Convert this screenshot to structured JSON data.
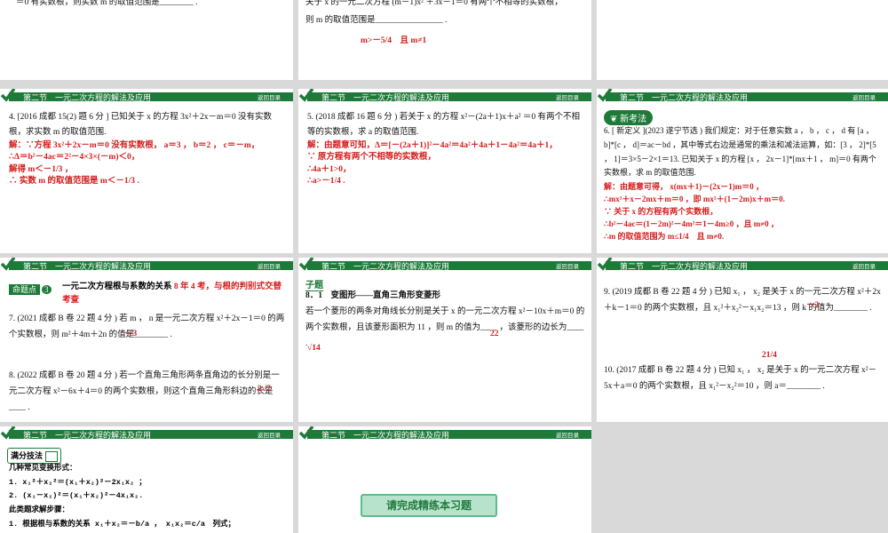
{
  "header_title": "第二节　一元二次方程的解法及应用",
  "back_label": "返回目录",
  "slides": {
    "s1": {
      "line": "＝0 有实数根，则实数 m 的取值范围是________ ."
    },
    "s2": {
      "l1": "关于 x 的一元二次方程 (m－1)x² ＋3x－1＝0 有两个不相等的实数根，",
      "l2": "则 m 的取值范围是________________ .",
      "answer": "m>－5/4　且 m≠1"
    },
    "s4": {
      "q": "4. [2016 成都 15(2) 题 6 分 ] 已知关于 x 的方程 3x²＋2x－m＝0 没有实数根，求实数 m 的取值范围.",
      "sol": [
        "解：∵方程 3x²＋2x－m＝0 没有实数根， a＝3 ， b＝2 ， c＝－m，",
        "∴Δ＝b²－4ac＝2²－4×3×(－m)＜0，",
        "解得 m＜－1/3 ，",
        "∴ 实数 m 的取值范围是 m＜－1/3 ."
      ]
    },
    "s5": {
      "q": "5. (2018 成都 16 题 6 分 ) 若关于 x 的方程 x²－(2a＋1)x＋a² ＝0 有两个不相等的实数根，求 a 的取值范围.",
      "sol": [
        "解：由题意可知，Δ＝[－(2a＋1)]²－4a²＝4a²＋4a＋1－4a²＝4a＋1，",
        "∵ 原方程有两个不相等的实数根，",
        "∴4a＋1>0，",
        "∴a>－1/4 ."
      ]
    },
    "s6": {
      "badge": "新考法",
      "q": "6. [ 新定义 ](2023 遂宁节选 ) 我们规定：对于任意实数 a ， b ， c ， d 有 [a ， b]*[c ， d]＝ac－bd ，其中等式右边是通常的乘法和减法运算，如：[3 ， 2]*[5 ， 1]＝3×5－2×1＝13. 已知关于 x 的方程 [x ， 2x－1]*[mx＋1 ， m]＝0 有两个实数根，求 m 的取值范围.",
      "sol": [
        "解：由题意可得， x(mx＋1)－(2x－1)m＝0 ，",
        "∴mx²＋x－2mx＋m＝0 ，即 mx²＋(1－2m)x＋m＝0.",
        "∵ 关于 x 的方程有两个实数根，",
        "∴b²－4ac＝(1－2m)²－4m²＝1－4m≥0 ，且 m≠0 ，",
        "∴m 的取值范围为 m≤1/4　且 m≠0."
      ]
    },
    "s7": {
      "tag_left": "命题点",
      "tag_num": "3",
      "title": "一元二次方程根与系数的关系",
      "title_red": "8 年 4 考，与根的判别式交替考查",
      "q7": "7. (2021 成都 B 卷 22 题 4 分 ) 若 m ， n 是一元二次方程 x²＋2x－1＝0 的两个实数根，则 m²＋4m＋2n 的值是________ .",
      "a7": "－3",
      "q8": "8. (2022 成都 B 卷 20 题 4 分 ) 若一个直角三角形两条直角边的长分别是一元二次方程 x²－6x＋4＝0 的两个实数根，则这个直角三角形斜边的长是____ .",
      "a8": "2√7"
    },
    "s8": {
      "tag": "子题",
      "line": "8．1　变图形——直角三角形变菱形",
      "q": "若一个菱形的两条对角线长分别是关于 x 的一元二次方程 x²－10x＋m＝0 的两个实数根，且该菱形面积为 11 ，则 m 的值为____ ，该菱形的边长为____ .",
      "a1": "22",
      "a2": "√14"
    },
    "s9": {
      "q9": "9. (2019 成都 B 卷 22 题 4 分 ) 已知 x₁ ， x₂ 是关于 x 的一元二次方程 x²＋2x＋k－1＝0 的两个实数根，且 x₁²＋x₂²－x₁x₂＝13 ，则 k 的值为________ .",
      "a9": "－2",
      "q10": "10. (2017 成都 B 卷 22 题 4 分 ) 已知 x₁ ， x₂ 是关于 x 的一元二次方程 x²－5x＋a＝0 的两个实数根，且 x₁²－x₂²＝10 ，则 a＝________ .",
      "a10": "21/4"
    },
    "s10": {
      "tag": "满分技法",
      "lines": [
        "几种常见变换形式：",
        "1. x₁²＋x₂²＝(x₁＋x₂)²－2x₁x₂ ；",
        "2. (x₁－x₂)²＝(x₁＋x₂)²－4x₁x₂.",
        "此类题求解步骤：",
        "1. 根据根与系数的关系 x₁＋x₂＝－b/a ， x₁x₂＝c/a　列式；"
      ]
    },
    "s11": {
      "button": "请完成精练本习题"
    }
  }
}
